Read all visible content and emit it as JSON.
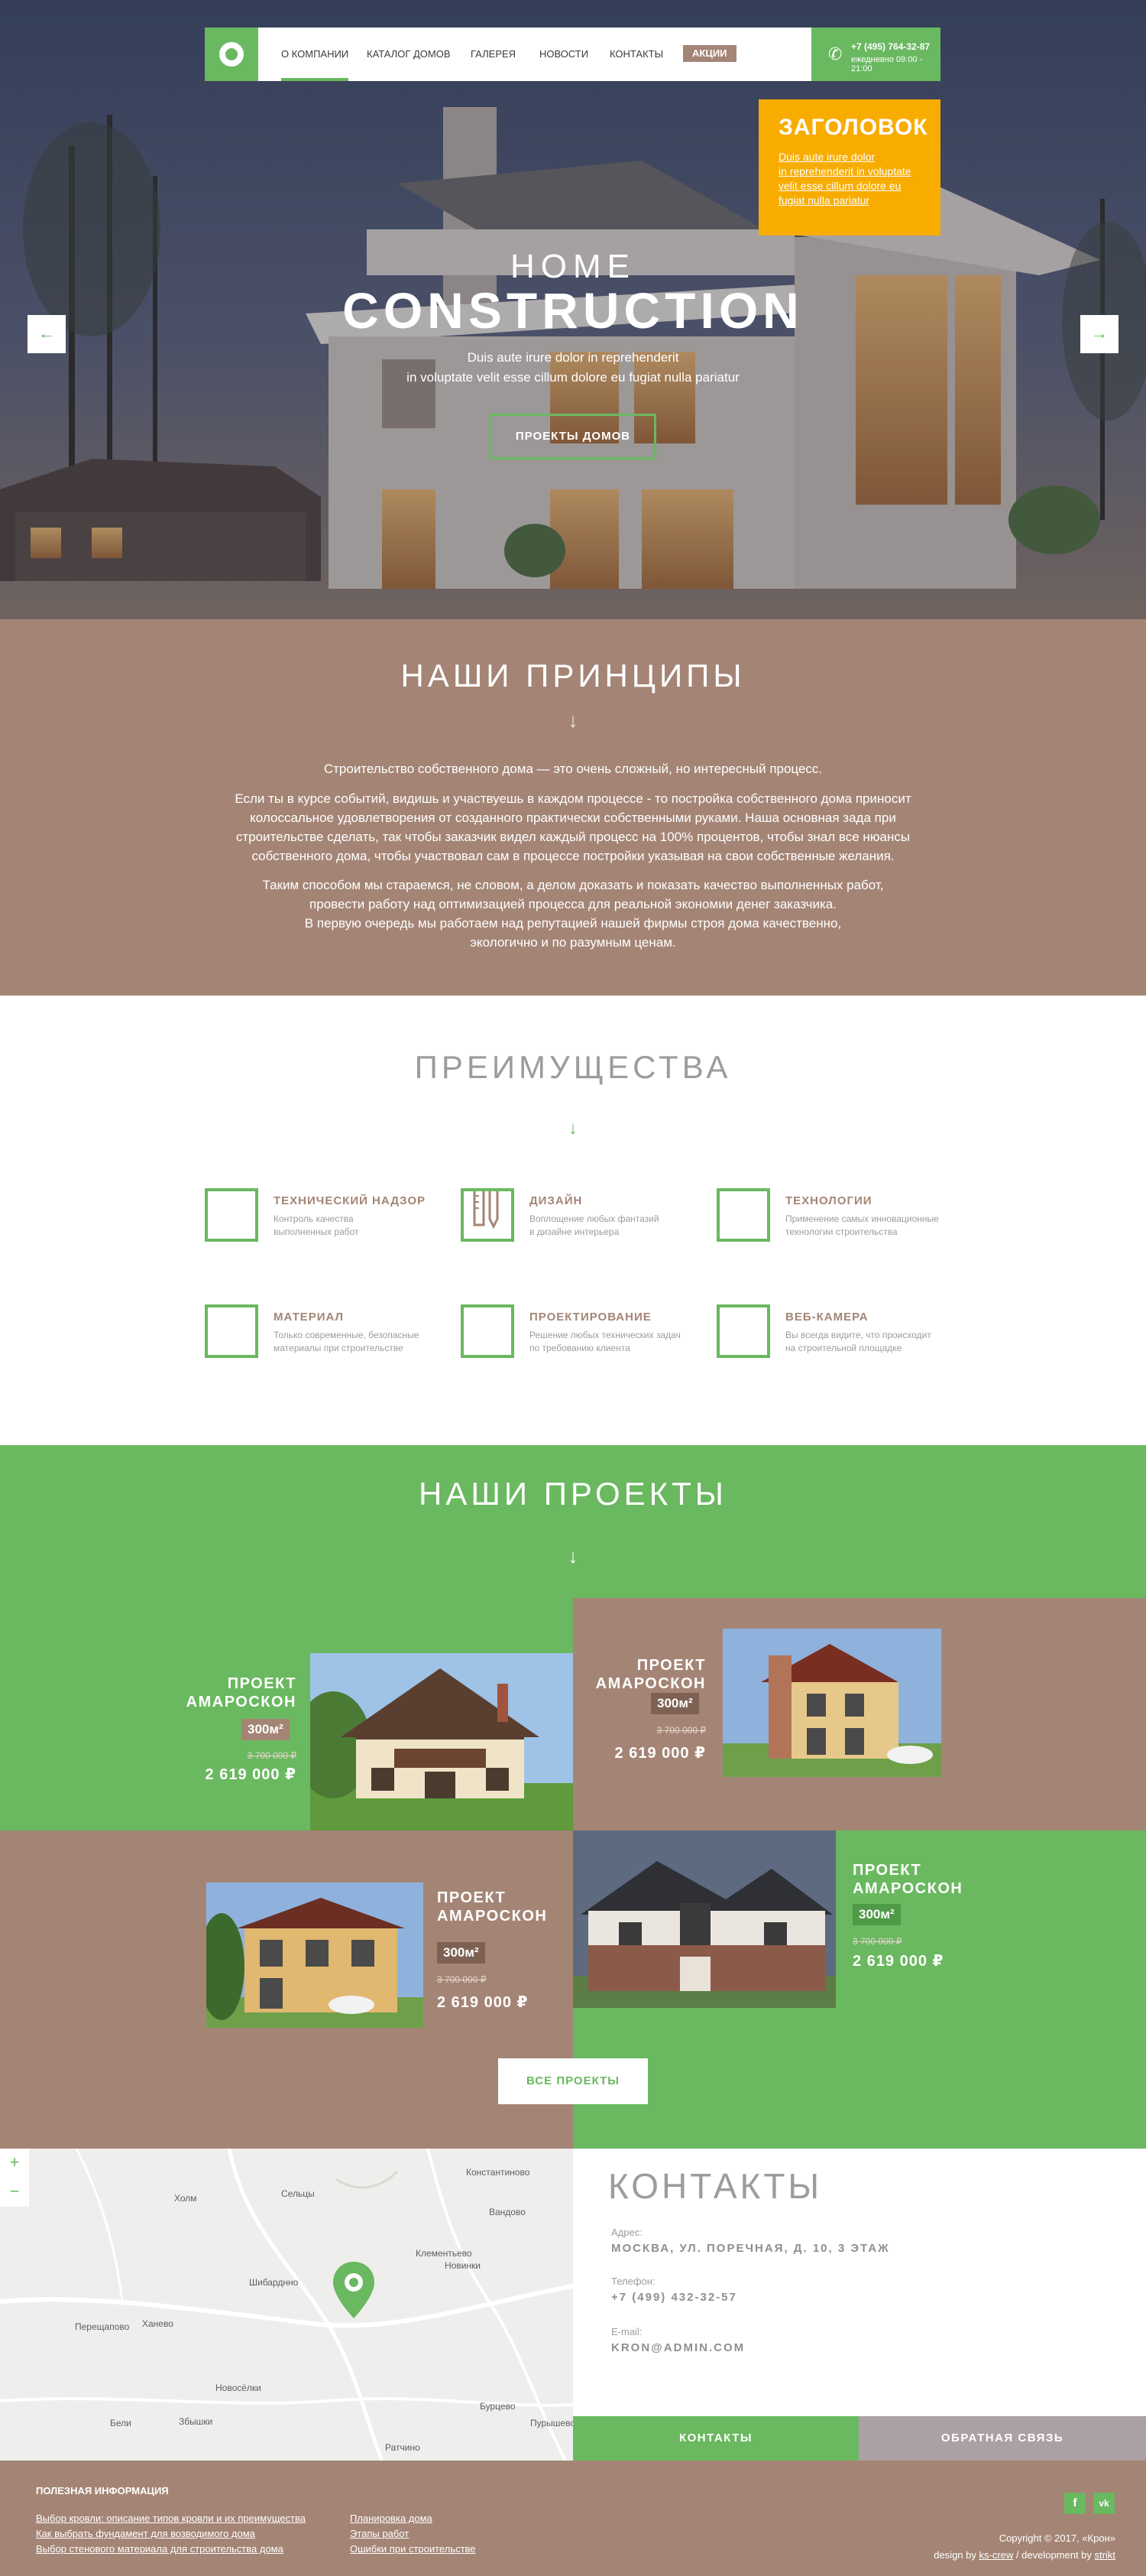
{
  "colors": {
    "green": "#6ab860",
    "brown": "#a48575",
    "orange": "#f8ac00",
    "grey": "#9c9c9c"
  },
  "nav": {
    "items": [
      "О КОМПАНИИ",
      "КАТАЛОГ ДОМОВ",
      "ГАЛЕРЕЯ",
      "НОВОСТИ",
      "КОНТАКТЫ"
    ],
    "promo": "АКЦИИ",
    "active_index": 0,
    "phone": "+7 (495) 764-32-87",
    "hours": "ежедневно 09:00 - 21:00"
  },
  "promo_box": {
    "title": "ЗАГОЛОВОК",
    "lines": [
      "Duis aute irure dolor",
      "in reprehenderit in voluptate",
      "velit esse cillum dolore eu",
      "fugiat nulla pariatur"
    ]
  },
  "hero": {
    "line1": "HOME",
    "line2": "CONSTRUCTION",
    "sub1": "Duis aute irure dolor in reprehenderit",
    "sub2": "in voluptate velit esse cillum dolore eu fugiat nulla pariatur",
    "button": "ПРОЕКТЫ ДОМОВ",
    "prev_icon": "arrow-left-icon",
    "next_icon": "arrow-right-icon"
  },
  "principles": {
    "title": "НАШИ ПРИНЦИПЫ",
    "arrow": "↓",
    "lead": "Строительство собственного дома — это очень сложный, но интересный процесс.",
    "p1": [
      "Если ты в курсе событий, видишь и участвуешь в каждом процессе - то постройка собственного дома приносит",
      "колоссальное удовлетворения от созданного практически собственными руками. Наша основная зада при",
      "строительстве сделать, так чтобы заказчик видел каждый процесс на 100% процентов, чтобы знал все нюансы",
      "собственного дома, чтобы участвовал сам в процессе постройки указывая на свои собственные желания."
    ],
    "p2": [
      "Таким способом мы стараемся, не словом, а делом доказать и показать качество выполненных работ,",
      "провести работу над оптимизацией процесса для реальной экономии денег заказчика.",
      "В первую очередь мы работаем над репутацией нашей фирмы строя дома качественно,",
      "экологично и по разумным ценам."
    ]
  },
  "advantages": {
    "title": "ПРЕИМУЩЕСТВА",
    "arrow": "↓",
    "items": [
      {
        "title": "ТЕХНИЧЕСКИЙ НАДЗОР",
        "desc": [
          "Контроль качества",
          "выполненных работ"
        ],
        "icon": "inspection-icon"
      },
      {
        "title": "ДИЗАЙН",
        "desc": [
          "Воплощение любых фантазий",
          "в дизайне интерьера"
        ],
        "icon": "ruler-pencil-icon"
      },
      {
        "title": "ТЕХНОЛОГИИ",
        "desc": [
          "Применение самых инновационные",
          "технологии строительства"
        ],
        "icon": "technology-icon"
      },
      {
        "title": "МАТЕРИАЛ",
        "desc": [
          "Только современные, безопасные",
          "материалы при строительстве"
        ],
        "icon": "material-icon"
      },
      {
        "title": "ПРОЕКТИРОВАНИЕ",
        "desc": [
          "Решение любых технических задач",
          "по требованию клиента"
        ],
        "icon": "design-plan-icon"
      },
      {
        "title": "ВЕБ-КАМЕРА",
        "desc": [
          "Вы всегда видите, что происходит",
          "на строительной площадке"
        ],
        "icon": "webcam-icon"
      }
    ]
  },
  "projects": {
    "title": "НАШИ ПРОЕКТЫ",
    "arrow": "↓",
    "items": [
      {
        "title1": "ПРОЕКТ",
        "title2": "АМАРОСКОН",
        "area": "300м²",
        "old_price": "3 700 000 ₽",
        "price": "2 619 000 ₽"
      },
      {
        "title1": "ПРОЕКТ",
        "title2": "АМАРОСКОН",
        "area": "300м²",
        "old_price": "3 700 000 ₽",
        "price": "2 619 000 ₽"
      },
      {
        "title1": "ПРОЕКТ",
        "title2": "АМАРОСКОН",
        "area": "300м²",
        "old_price": "3 700 000 ₽",
        "price": "2 619 000 ₽"
      },
      {
        "title1": "ПРОЕКТ",
        "title2": "АМАРОСКОН",
        "area": "300м²",
        "old_price": "3 700 000 ₽",
        "price": "2 619 000 ₽"
      }
    ],
    "all_button": "ВСЕ ПРОЕКТЫ"
  },
  "map": {
    "zoom_in": "+",
    "zoom_out": "−",
    "places": [
      "Константиново",
      "Холм",
      "Сельцы",
      "Вандово",
      "Клементьево",
      "Новинки",
      "Шибарднно",
      "Перещапово",
      "Ханево",
      "Новосёлки",
      "Бели",
      "Збышки",
      "Бурцево",
      "Ратчино",
      "Пурышево"
    ]
  },
  "contacts": {
    "title": "КОНТАКТЫ",
    "address_label": "Адрес:",
    "address": "МОСКВА, УЛ. ПОРЕЧНАЯ, Д. 10, 3 ЭТАЖ",
    "phone_label": "Телефон:",
    "phone": "+7 (499) 432-32-57",
    "email_label": "E-mail:",
    "email": "KRON@ADMIN.COM",
    "btn_contacts": "КОНТАКТЫ",
    "btn_feedback": "ОБРАТНАЯ СВЯЗЬ"
  },
  "footer": {
    "title": "ПОЛЕЗНАЯ ИНФОРМАЦИЯ",
    "links_col1": [
      "Выбор кровли: описание типов кровли и их преимущества",
      "Как выбрать фундамент для возводимого дома",
      "Выбор стенового материала для строительства дома"
    ],
    "links_col2": [
      "Планировка дома",
      "Этапы работ",
      "Ошибки при строительстве"
    ],
    "social": [
      "f",
      "vk"
    ],
    "copyright": "Copyright ©  2017, «Крон»",
    "credit_design": "design by",
    "credit_design_name": "ks-crew",
    "credit_dev": "/ development by",
    "credit_dev_name": "strikt"
  }
}
